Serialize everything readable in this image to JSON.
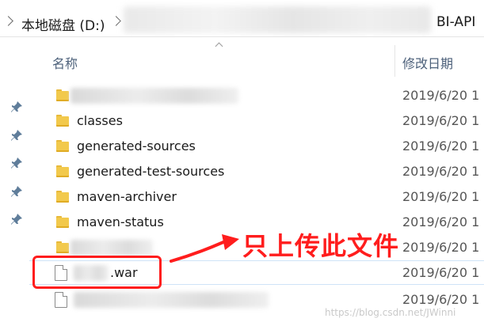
{
  "address": {
    "root_label": "本地磁盘 (D:)",
    "tail_label": "BI-API"
  },
  "columns": {
    "name": "名称",
    "date": "修改日期"
  },
  "files": [
    {
      "type": "folder",
      "name": "",
      "redacted": true,
      "date": "2019/6/20 1"
    },
    {
      "type": "folder",
      "name": "classes",
      "date": "2019/6/20 1"
    },
    {
      "type": "folder",
      "name": "generated-sources",
      "date": "2019/6/20 1"
    },
    {
      "type": "folder",
      "name": "generated-test-sources",
      "date": "2019/6/20 1"
    },
    {
      "type": "folder",
      "name": "maven-archiver",
      "date": "2019/6/20 1"
    },
    {
      "type": "folder",
      "name": "maven-status",
      "date": "2019/6/20 1"
    },
    {
      "type": "folder",
      "name": "",
      "redacted": true,
      "date": "2019/6/20 1"
    },
    {
      "type": "file",
      "name": ".war",
      "redacted_prefix": true,
      "date": "2019/6/20 1",
      "highlighted": true
    },
    {
      "type": "file",
      "name": "",
      "redacted": true,
      "date": "2019/6/20 1"
    }
  ],
  "annotation": {
    "text": "只上传此文件",
    "color": "#ff1d1d"
  },
  "watermark": "https://blog.csdn.net/JWinni",
  "icons": {
    "nav_chevron": "chevron-right-icon",
    "pin": "pin-icon",
    "folder": "folder-icon",
    "file": "file-icon"
  }
}
